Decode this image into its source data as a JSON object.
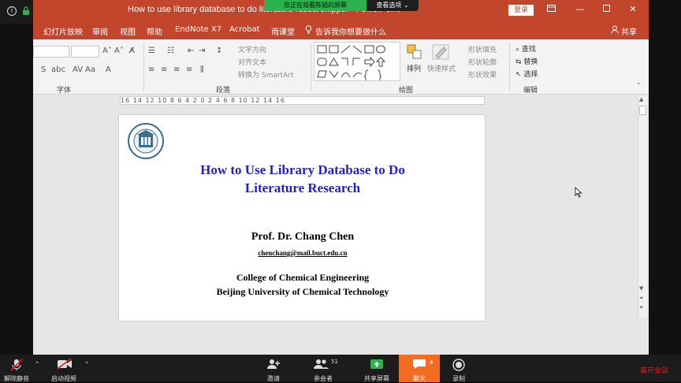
{
  "ppt": {
    "title": "How to use library database to do literature research.pptx - PowerPoint",
    "share_banner": "您正在观看陈韬的屏幕",
    "view_options": "查看选项 ⌄",
    "login": "登录",
    "share": "共享",
    "menu": [
      "幻灯片放映",
      "审阅",
      "视图",
      "帮助",
      "EndNote X7",
      "Acrobat",
      "雨课堂"
    ],
    "tell_me": "告诉我你想要做什么"
  },
  "ribbon": {
    "groups": [
      "字体",
      "段落",
      "绘图",
      "编辑"
    ],
    "text_direction": "文字方向",
    "align_text": "对齐文本",
    "smartart": "转换为 SmartArt",
    "arrange": "排列",
    "quick_styles": "快速样式",
    "shape_fill": "形状填充",
    "shape_outline": "形状轮廓",
    "shape_effects": "形状效果",
    "find": "查找",
    "replace": "替换",
    "select": "选择"
  },
  "ruler": "16 14 12 10 8 6 4 2 0 2 4 6 8 10 12 14 16",
  "slide": {
    "title_line1": "How to Use Library Database to Do",
    "title_line2": "Literature Research",
    "author": "Prof. Dr.  Chang Chen",
    "email": "chenchang@mail.buct.edu.cn",
    "college": "College of Chemical Engineering",
    "university": "Beijing University of Chemical Technology"
  },
  "zoom": {
    "unmute": "解除静音",
    "start_video": "启动视频",
    "invite": "邀请",
    "participants": "参会者",
    "participants_count": "51",
    "share_screen": "共享屏幕",
    "chat": "聊天",
    "chat_count": "4",
    "record": "录制",
    "leave": "离开会议"
  },
  "colors": {
    "ppt_accent": "#c1462b",
    "slide_title": "#1f1fcc",
    "zoom_chat": "#f26d21",
    "zoom_leave": "#e2231a"
  }
}
